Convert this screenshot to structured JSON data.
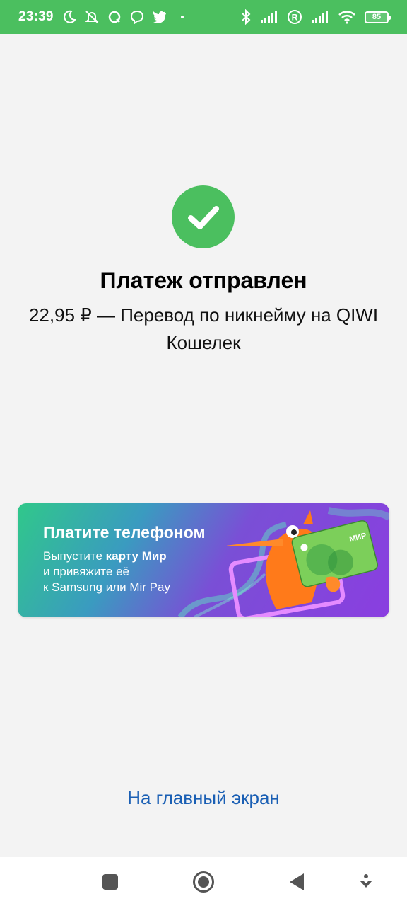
{
  "status_bar": {
    "time": "23:39",
    "battery": "85",
    "left_icons": [
      "moon-icon",
      "bell-off-icon",
      "chat-icon",
      "viber-icon",
      "twitter-icon"
    ],
    "right_icons": [
      "bluetooth-icon",
      "signal-icon",
      "roaming-icon",
      "signal-icon",
      "wifi-icon"
    ],
    "color": "#4bbf5f"
  },
  "result": {
    "icon": "check-icon",
    "title": "Платеж отправлен",
    "subtitle": "22,95 ₽ — Перевод по никнейму на QIWI Кошелек",
    "accent_color": "#4bbf5f"
  },
  "banner": {
    "title": "Платите телефоном",
    "line1_prefix": "Выпустите ",
    "line1_bold": "карту Мир",
    "line2": "и привяжите её",
    "line3": "к Samsung или Mir Pay",
    "card_label": "МИР"
  },
  "home_link": {
    "label": "На главный экран",
    "color": "#1a5fb4"
  },
  "nav_bar": {
    "buttons": [
      "recents-square-icon",
      "home-circle-icon",
      "back-triangle-icon",
      "assistant-icon"
    ]
  }
}
